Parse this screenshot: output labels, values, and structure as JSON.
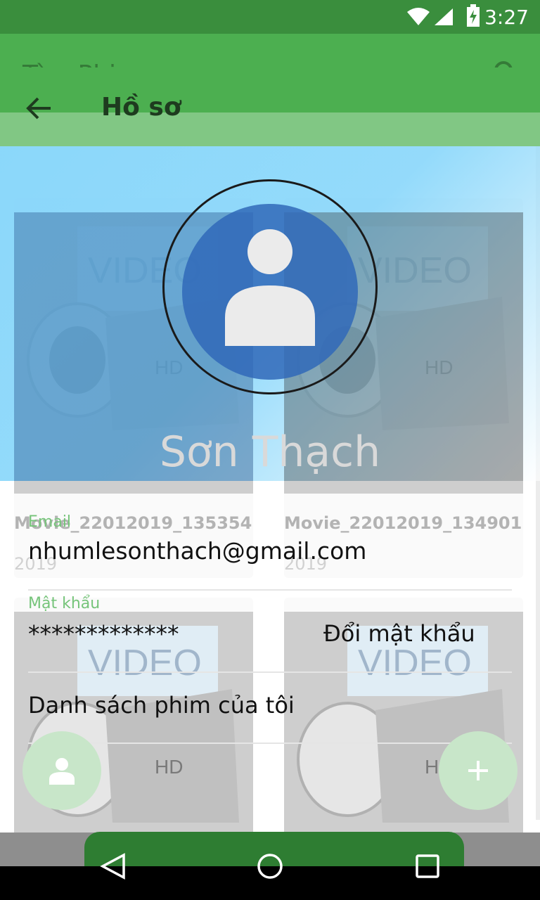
{
  "status_bar": {
    "time": "3:27"
  },
  "list_screen": {
    "title": "Tìm Phim",
    "cards": [
      {
        "title": "Movie_22012019_135354",
        "year": "2019"
      },
      {
        "title": "Movie_22012019_134901",
        "year": "2019"
      }
    ]
  },
  "profile": {
    "title": "Hồ sơ",
    "name": "Sơn Thạch",
    "email_label": "Email",
    "email_value": "nhumlesonthach@gmail.com",
    "password_label": "Mật khẩu",
    "password_value": "*************",
    "change_password_label": "Đổi mật khẩu",
    "my_movies_label": "Danh sách phim của tôi"
  },
  "colors": {
    "primary": "#4caf50",
    "primary_dark": "#3a8e3d",
    "accent": "#81d4fa",
    "fab": "#c8e6c9"
  },
  "icons": [
    "back-arrow-icon",
    "search-icon",
    "user-icon",
    "add-icon",
    "nav-back-icon",
    "nav-home-icon",
    "nav-recents-icon",
    "wifi-icon",
    "signal-icon",
    "battery-icon"
  ]
}
